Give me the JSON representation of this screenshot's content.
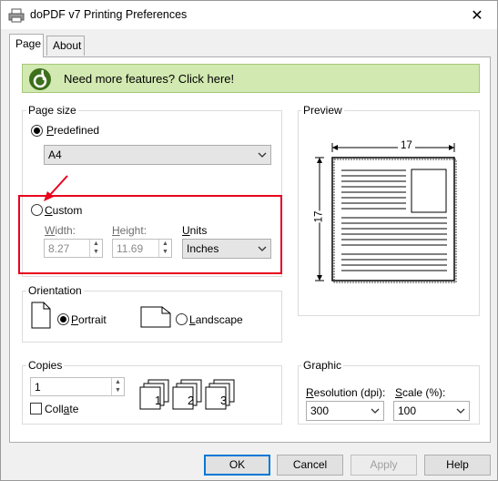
{
  "window": {
    "title": "doPDF v7 Printing Preferences",
    "close_glyph": "✕"
  },
  "tabs": [
    {
      "label": "Page",
      "active": true
    },
    {
      "label": "About",
      "active": false
    }
  ],
  "banner": {
    "text": "Need more features? Click here!"
  },
  "page_size": {
    "legend": "Page size",
    "predefined": {
      "label_prefix": "",
      "label_accel": "P",
      "label_rest": "redefined",
      "selected": true
    },
    "paper": {
      "value": "A4"
    },
    "custom": {
      "label_accel": "C",
      "label_rest": "ustom",
      "selected": false
    },
    "width": {
      "label_accel": "W",
      "label_rest": "idth:",
      "value": "8.27"
    },
    "height": {
      "label_accel": "H",
      "label_rest": "eight:",
      "value": "11.69"
    },
    "units": {
      "label_accel": "U",
      "label_rest": "nits",
      "value": "Inches"
    }
  },
  "preview": {
    "legend": "Preview",
    "width_label": "17",
    "height_label": "17"
  },
  "orientation": {
    "legend": "Orientation",
    "portrait": {
      "label_accel": "P",
      "label_rest": "ortrait",
      "selected": true
    },
    "landscape": {
      "label_accel": "L",
      "label_rest": "andscape",
      "selected": false
    }
  },
  "copies": {
    "legend": "Copies",
    "value": "1",
    "collate": {
      "label_pre": "Coll",
      "label_accel": "a",
      "label_rest": "te",
      "checked": false
    },
    "page_numbers": [
      "1",
      "2",
      "3"
    ]
  },
  "graphic": {
    "legend": "Graphic",
    "resolution": {
      "label_accel": "R",
      "label_rest": "esolution (dpi):",
      "value": "300"
    },
    "scale": {
      "label_accel": "S",
      "label_rest": "cale (%):",
      "value": "100"
    }
  },
  "buttons": {
    "ok": "OK",
    "cancel": "Cancel",
    "apply": "Apply",
    "help": "Help"
  },
  "colors": {
    "banner_bg": "#d2e9b1",
    "highlight": "#e8001c",
    "arrow": "#e8001c",
    "default_button_border": "#0078d7"
  }
}
